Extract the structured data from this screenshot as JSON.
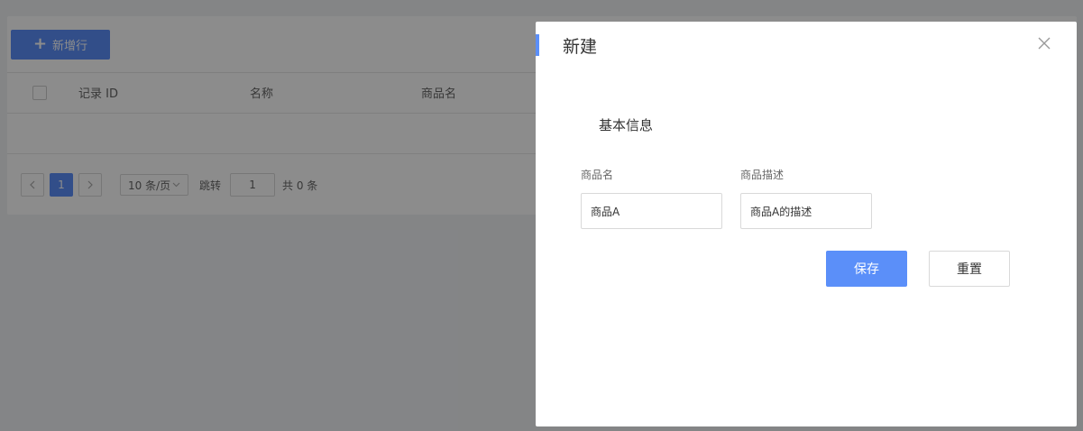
{
  "toolbar": {
    "add_row_label": "新增行"
  },
  "table": {
    "columns": [
      "记录 ID",
      "名称",
      "商品名"
    ]
  },
  "pagination": {
    "prev_icon": "chevron-left-icon",
    "current_page": "1",
    "next_icon": "chevron-right-icon",
    "page_size": "10 条/页",
    "jump_label": "跳转",
    "jump_value": "1",
    "total": "共 0 条"
  },
  "drawer": {
    "title": "新建",
    "section_title": "基本信息",
    "fields": [
      {
        "label": "商品名",
        "value": "商品A"
      },
      {
        "label": "商品描述",
        "value": "商品A的描述"
      }
    ],
    "save_label": "保存",
    "reset_label": "重置"
  },
  "colors": {
    "accent": "#5b8ff9"
  }
}
